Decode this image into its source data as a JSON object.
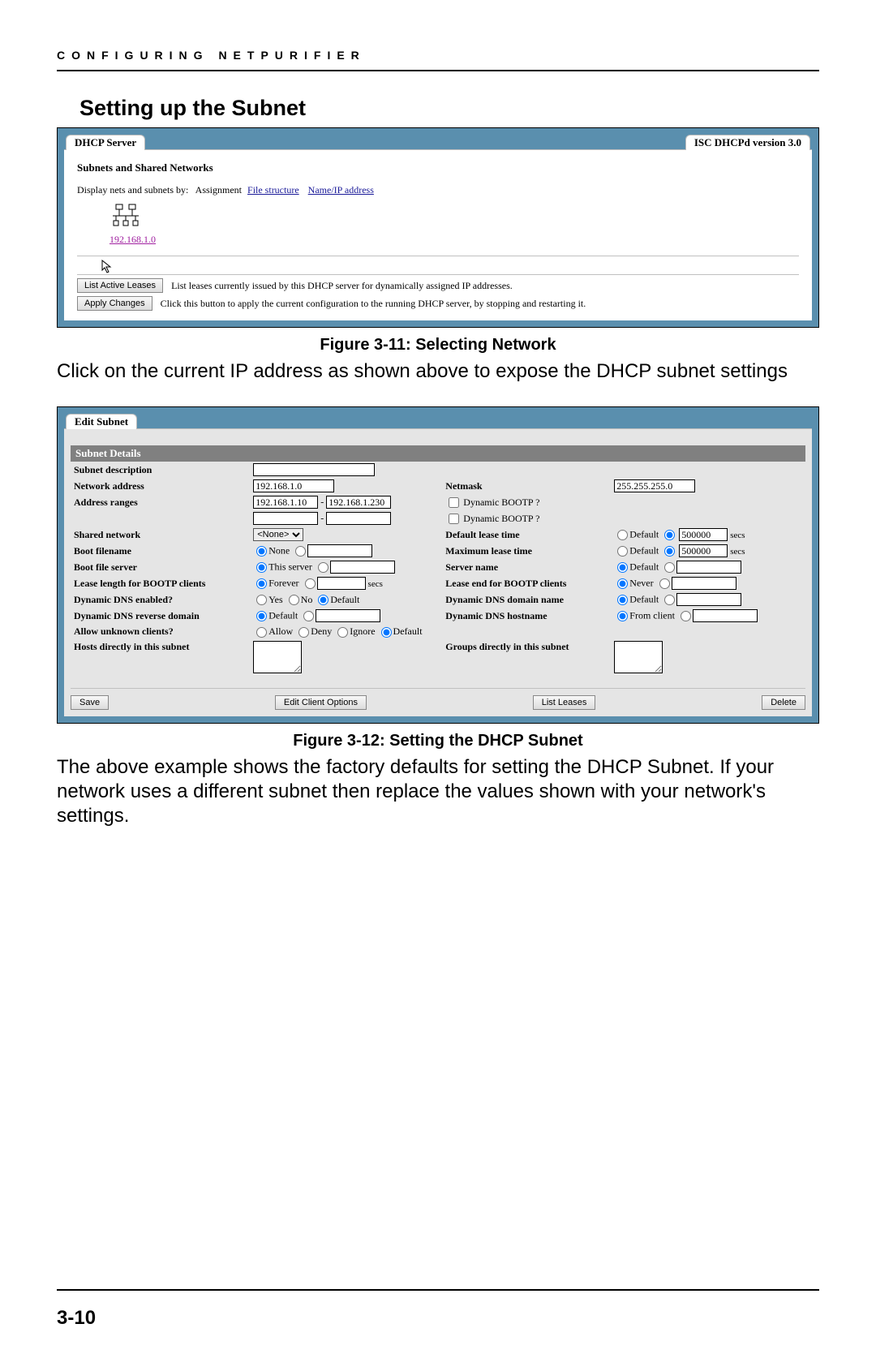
{
  "chapter_head": "CONFIGURING NETPURIFIER",
  "section_title": "Setting up the Subnet",
  "fig1": {
    "tab_left": "DHCP Server",
    "tab_right": "ISC DHCPd version 3.0",
    "subhead": "Subnets and Shared Networks",
    "display_label": "Display nets and subnets by:",
    "assignment": "Assignment",
    "link_filestruct": "File structure",
    "link_nameip": "Name/IP address",
    "net_link": "192.168.1.0",
    "btn_list_leases": "List Active Leases",
    "desc_list_leases": "List leases currently issued by this DHCP server for dynamically assigned IP addresses.",
    "btn_apply": "Apply Changes",
    "desc_apply": "Click this button to apply the current configuration to the running DHCP server, by stopping and restarting it."
  },
  "caption1": "Figure 3-11: Selecting Network",
  "para1": "Click on the current IP address as shown above to expose the DHCP subnet settings",
  "fig2": {
    "tab_left": "Edit Subnet",
    "bar": "Subnet Details",
    "labels": {
      "subnet_desc": "Subnet description",
      "network_addr": "Network address",
      "netmask": "Netmask",
      "address_ranges": "Address ranges",
      "dyn_bootp": "Dynamic BOOTP ?",
      "shared_net": "Shared network",
      "default_lease": "Default lease time",
      "boot_filename": "Boot filename",
      "max_lease": "Maximum lease time",
      "boot_file_server": "Boot file server",
      "server_name": "Server name",
      "lease_len_bootp": "Lease length for BOOTP clients",
      "lease_end_bootp": "Lease end for BOOTP clients",
      "dyn_dns_enabled": "Dynamic DNS enabled?",
      "dyn_dns_domain": "Dynamic DNS domain name",
      "dyn_dns_revdom": "Dynamic DNS reverse domain",
      "dyn_dns_host": "Dynamic DNS hostname",
      "allow_unknown": "Allow unknown clients?",
      "hosts_direct": "Hosts directly in this subnet",
      "groups_direct": "Groups directly in this subnet"
    },
    "values": {
      "network_addr": "192.168.1.0",
      "netmask": "255.255.255.0",
      "range_start": "192.168.1.10",
      "range_end": "192.168.1.230",
      "shared_none": "<None>",
      "default_lease_val": "500000",
      "max_lease_val": "500000"
    },
    "radios": {
      "none": "None",
      "default": "Default",
      "this_server": "This server",
      "forever": "Forever",
      "never": "Never",
      "yes": "Yes",
      "no": "No",
      "allow": "Allow",
      "deny": "Deny",
      "ignore": "Ignore",
      "from_client": "From client"
    },
    "secs": "secs",
    "buttons": {
      "save": "Save",
      "edit_client": "Edit Client Options",
      "list_leases": "List Leases",
      "delete": "Delete"
    }
  },
  "caption2": "Figure 3-12: Setting the DHCP Subnet",
  "para2": "The above example shows the factory defaults for setting the DHCP Subnet. If your network uses a different subnet then replace the values shown with your network's settings.",
  "page_num": "3-10"
}
